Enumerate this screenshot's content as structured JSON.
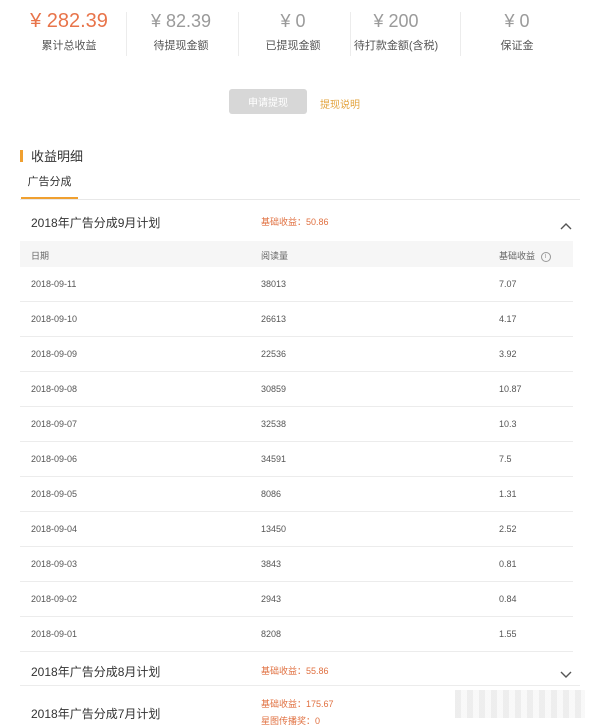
{
  "stats": [
    {
      "amount": "¥ 282.39",
      "label": "累计总收益"
    },
    {
      "amount": "¥ 82.39",
      "label": "待提现金额"
    },
    {
      "amount": "¥ 0",
      "label": "已提现金额"
    },
    {
      "amount": "¥ 200",
      "label": "待打款金额(含税)"
    },
    {
      "amount": "¥ 0",
      "label": "保证金"
    }
  ],
  "actions": {
    "apply_label": "申请提现",
    "rules_label": "提现说明"
  },
  "section": {
    "title": "收益明细"
  },
  "tabs": [
    {
      "label": "广告分成"
    }
  ],
  "colors": {
    "accent": "#f0a030",
    "income": "#e07040",
    "highlight_amount": "#e8744a"
  },
  "table": {
    "headers": {
      "date": "日期",
      "reads": "阅读量",
      "income": "基础收益"
    },
    "rows": [
      {
        "date": "2018-09-11",
        "reads": "38013",
        "income": "7.07"
      },
      {
        "date": "2018-09-10",
        "reads": "26613",
        "income": "4.17"
      },
      {
        "date": "2018-09-09",
        "reads": "22536",
        "income": "3.92"
      },
      {
        "date": "2018-09-08",
        "reads": "30859",
        "income": "10.87"
      },
      {
        "date": "2018-09-07",
        "reads": "32538",
        "income": "10.3"
      },
      {
        "date": "2018-09-06",
        "reads": "34591",
        "income": "7.5"
      },
      {
        "date": "2018-09-05",
        "reads": "8086",
        "income": "1.31"
      },
      {
        "date": "2018-09-04",
        "reads": "13450",
        "income": "2.52"
      },
      {
        "date": "2018-09-03",
        "reads": "3843",
        "income": "0.81"
      },
      {
        "date": "2018-09-02",
        "reads": "2943",
        "income": "0.84"
      },
      {
        "date": "2018-09-01",
        "reads": "8208",
        "income": "1.55"
      }
    ]
  },
  "plans": [
    {
      "title": "2018年广告分成9月计划",
      "income": "基础收益：50.86",
      "expanded": true
    },
    {
      "title": "2018年广告分成8月计划",
      "income": "基础收益：55.86",
      "expanded": false
    },
    {
      "title": "2018年广告分成7月计划",
      "income": "基础收益：175.67",
      "extra": "星图传播奖：0",
      "expanded": false
    }
  ]
}
